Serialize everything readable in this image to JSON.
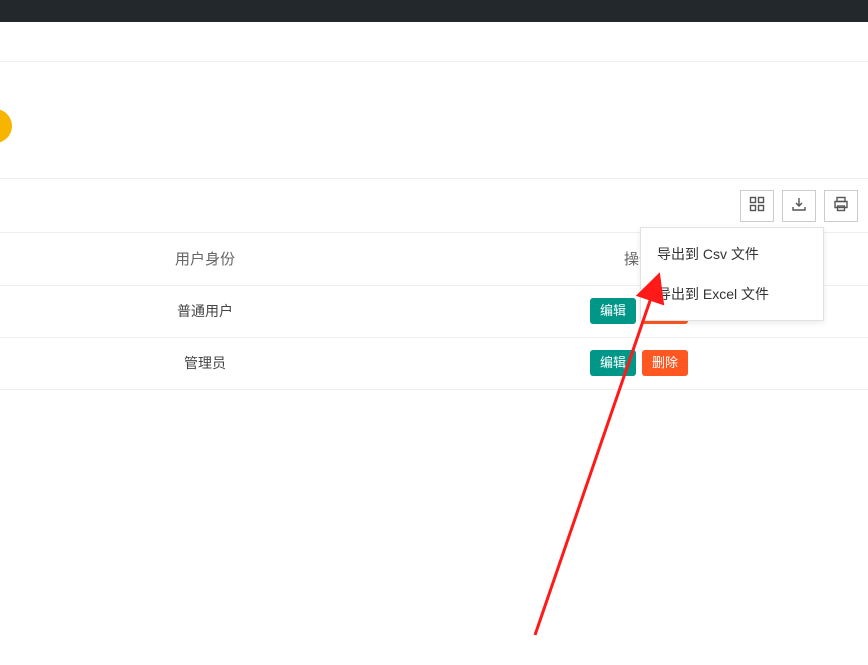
{
  "table": {
    "columns": {
      "role": "用户身份",
      "actions": "操作"
    },
    "rows": [
      {
        "role": "普通用户",
        "edit": "编辑",
        "delete": "删除"
      },
      {
        "role": "管理员",
        "edit": "编辑",
        "delete": "删除"
      }
    ]
  },
  "dropdown": {
    "items": [
      {
        "label": "导出到 Csv 文件"
      },
      {
        "label": "导出到 Excel 文件"
      }
    ]
  },
  "colors": {
    "edit": "#009688",
    "delete": "#ff5722",
    "pill": "#f7b500",
    "arrow": "#ff1a1a"
  }
}
